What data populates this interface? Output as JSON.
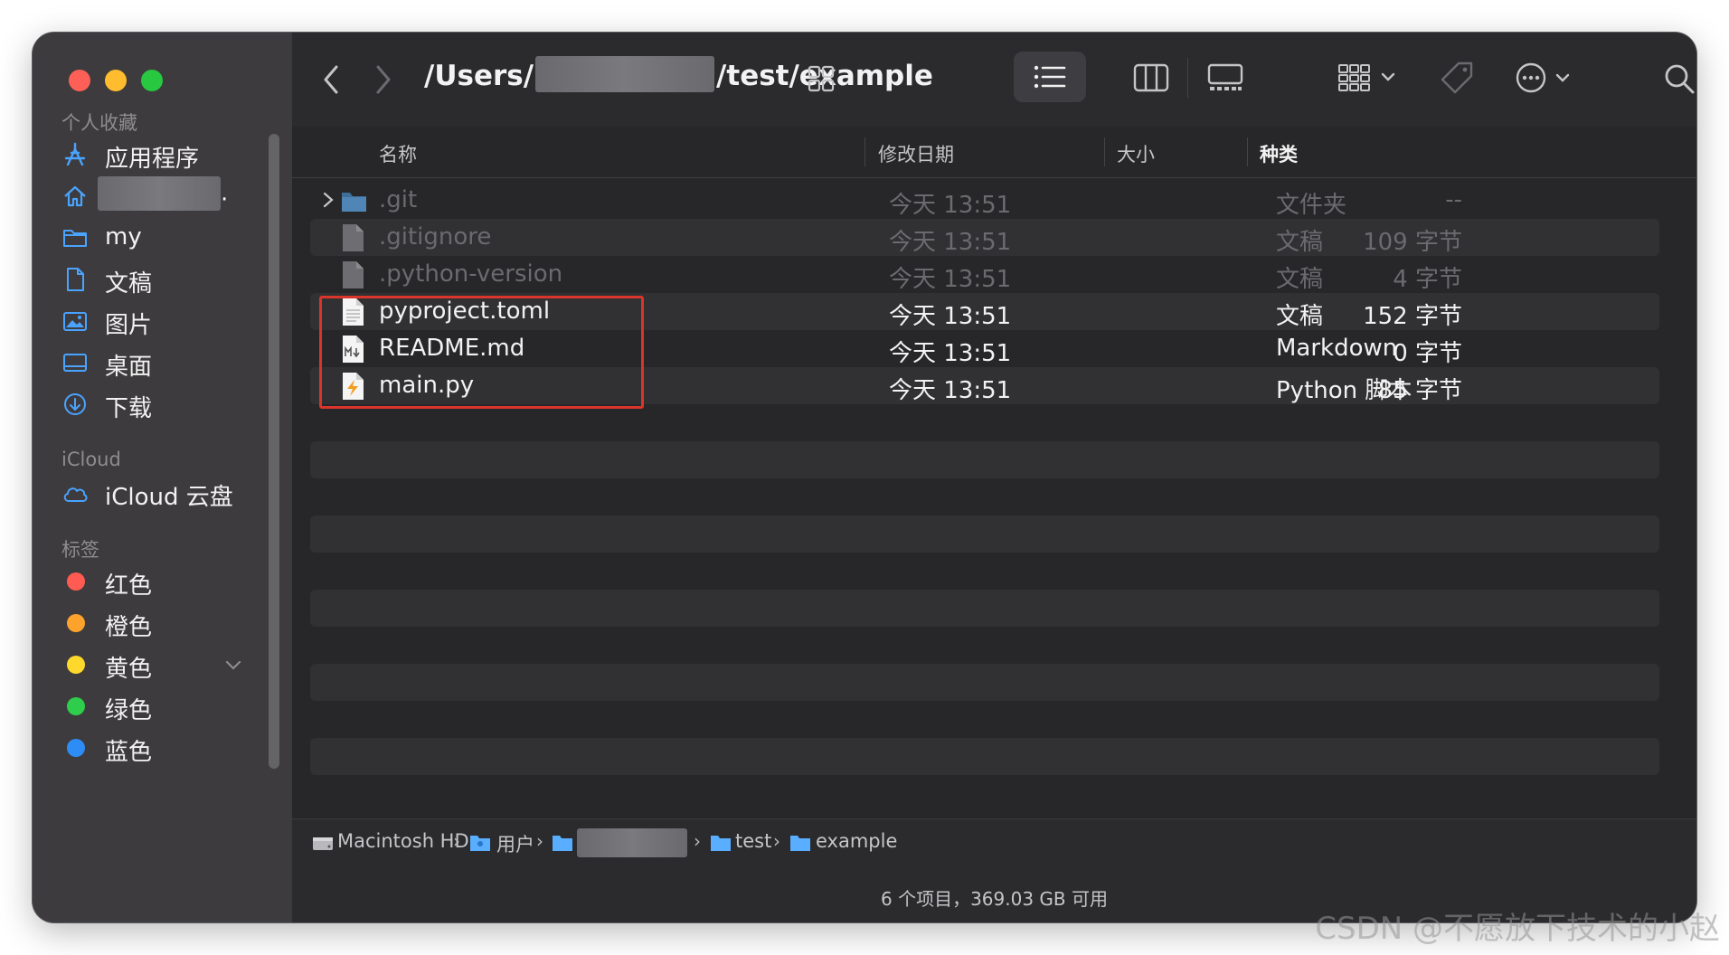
{
  "window": {
    "traffic_lights": [
      "#fe5f57",
      "#febc2e",
      "#28c840"
    ]
  },
  "sidebar": {
    "favorites_heading": "个人收藏",
    "favorites": [
      {
        "label": "应用程序",
        "icon": "apps-icon"
      },
      {
        "label": ".",
        "icon": "home-icon"
      },
      {
        "label": "my",
        "icon": "folder-icon"
      },
      {
        "label": "文稿",
        "icon": "document-icon"
      },
      {
        "label": "图片",
        "icon": "pictures-icon"
      },
      {
        "label": "桌面",
        "icon": "desktop-icon"
      },
      {
        "label": "下载",
        "icon": "download-icon"
      }
    ],
    "icloud_heading": "iCloud",
    "icloud_items": [
      {
        "label": "iCloud 云盘",
        "icon": "cloud-icon"
      }
    ],
    "tags_heading": "标签",
    "tags": [
      {
        "label": "红色",
        "color": "#ff5b52"
      },
      {
        "label": "橙色",
        "color": "#fda32c"
      },
      {
        "label": "黄色",
        "color": "#fed92c"
      },
      {
        "label": "绿色",
        "color": "#2fcd4c"
      },
      {
        "label": "蓝色",
        "color": "#2e8cf6"
      }
    ]
  },
  "toolbar": {
    "path_prefix": "/Users/",
    "path_suffix": "/test/example"
  },
  "columns": {
    "name": "名称",
    "date": "修改日期",
    "size": "大小",
    "kind": "种类"
  },
  "files": [
    {
      "name": ".git",
      "date": "今天 13:51",
      "size": "--",
      "kind": "文件夹",
      "hidden": true,
      "icon": "folder-icon"
    },
    {
      "name": ".gitignore",
      "date": "今天 13:51",
      "size": "109 字节",
      "kind": "文稿",
      "hidden": true,
      "icon": "generic-file-icon"
    },
    {
      "name": ".python-version",
      "date": "今天 13:51",
      "size": "4 字节",
      "kind": "文稿",
      "hidden": true,
      "icon": "generic-file-icon"
    },
    {
      "name": "pyproject.toml",
      "date": "今天 13:51",
      "size": "152 字节",
      "kind": "文稿",
      "hidden": false,
      "icon": "text-file-icon"
    },
    {
      "name": "README.md",
      "date": "今天 13:51",
      "size": "0 字节",
      "kind": "Markdown",
      "hidden": false,
      "icon": "markdown-file-icon"
    },
    {
      "name": "main.py",
      "date": "今天 13:51",
      "size": "85 字节",
      "kind": "Python 脚本",
      "hidden": false,
      "icon": "python-file-icon"
    }
  ],
  "pathbar": {
    "disk": "Macintosh HD",
    "users": "用户",
    "folder1": "test",
    "folder2": "example",
    "separator": "›"
  },
  "status": {
    "text": "6 个项目，369.03 GB 可用"
  },
  "watermark": "CSDN @不愿放下技术的小赵"
}
